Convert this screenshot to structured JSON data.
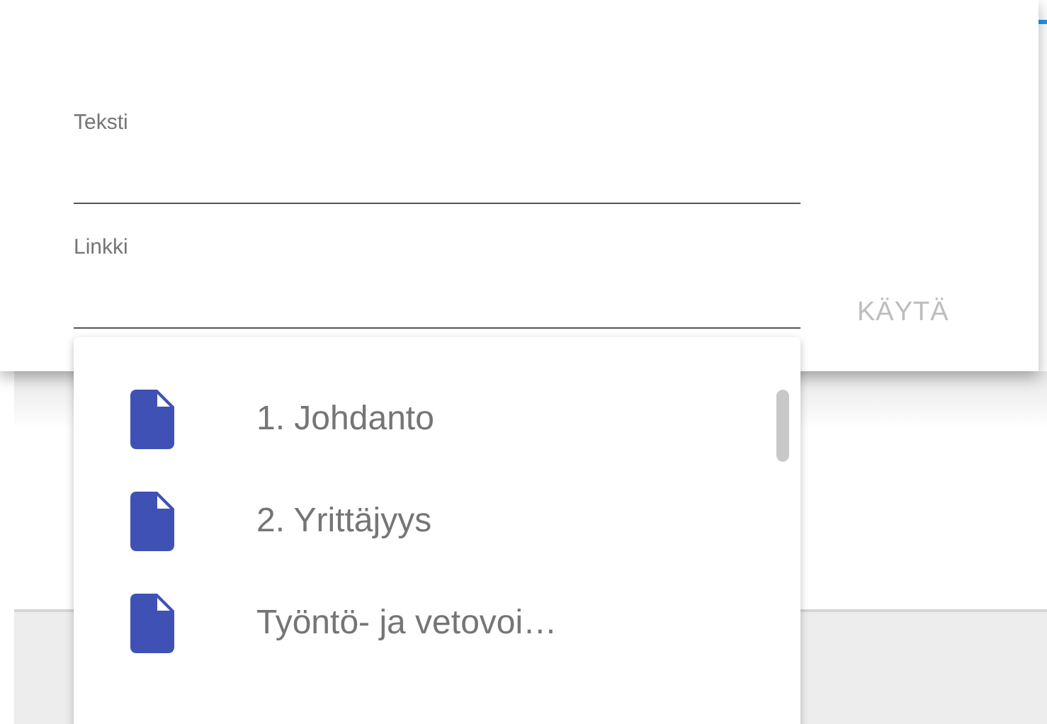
{
  "dialog": {
    "fields": [
      {
        "label": "Teksti"
      },
      {
        "label": "Linkki"
      }
    ],
    "button": {
      "label": "KÄYTÄ",
      "disabled": true
    }
  },
  "suggestions": [
    {
      "title": "1. Johdanto"
    },
    {
      "title": "2. Yrittäjyys"
    },
    {
      "title": "Työntö- ja vetovoi…"
    }
  ]
}
